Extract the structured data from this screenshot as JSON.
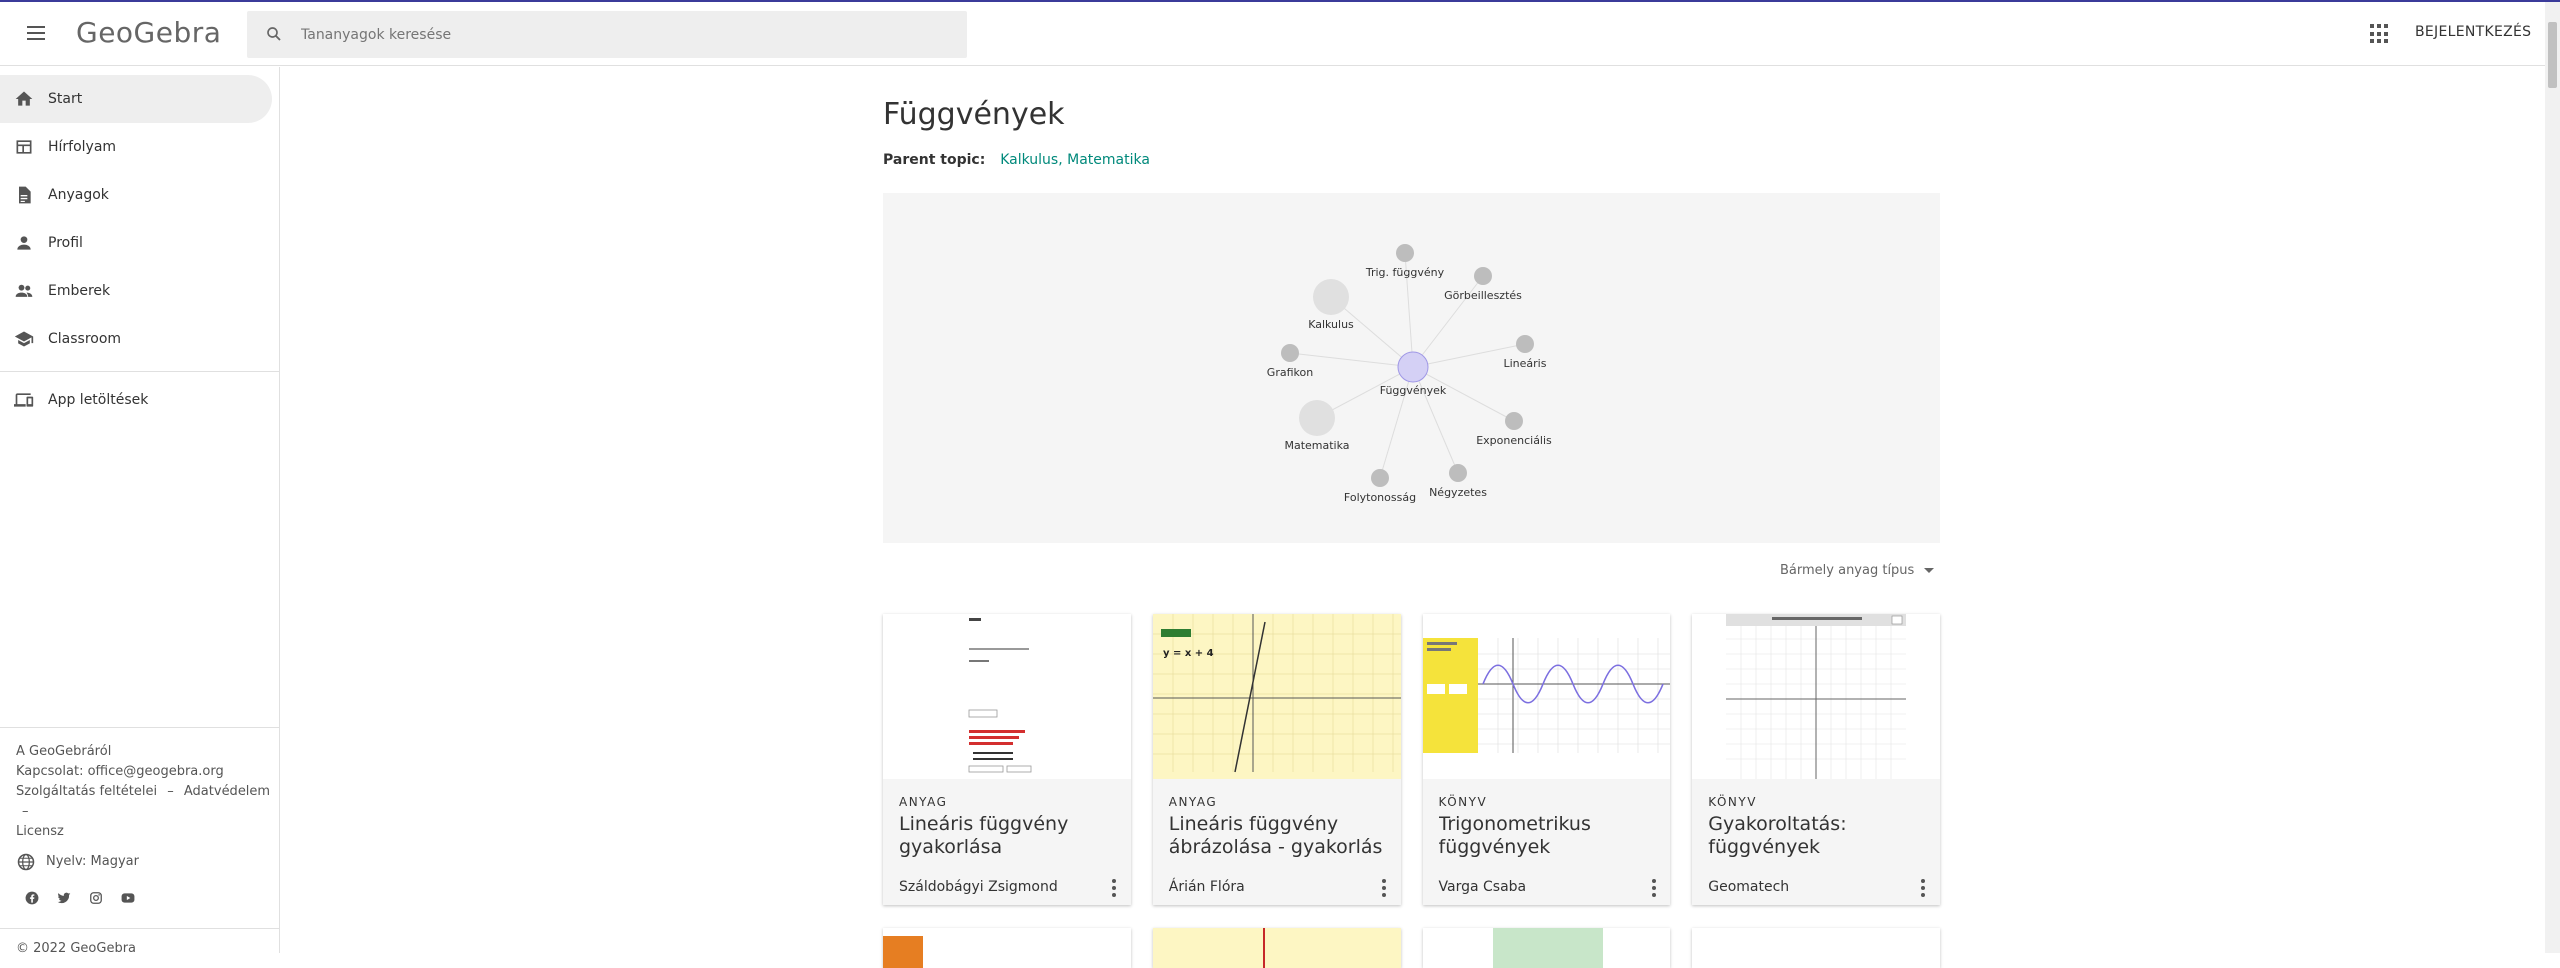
{
  "app": {
    "logo": "GeoGebra"
  },
  "header": {
    "search_placeholder": "Tananyagok keresése",
    "login_label": "BEJELENTKEZÉS"
  },
  "sidebar": {
    "items": [
      {
        "label": "Start",
        "icon": "home-icon"
      },
      {
        "label": "Hírfolyam",
        "icon": "feed-icon"
      },
      {
        "label": "Anyagok",
        "icon": "document-icon"
      },
      {
        "label": "Profil",
        "icon": "person-icon"
      },
      {
        "label": "Emberek",
        "icon": "people-icon"
      },
      {
        "label": "Classroom",
        "icon": "school-icon"
      }
    ],
    "app_downloads": "App letöltések",
    "footer": {
      "about": "A GeoGebráról",
      "contact": "Kapcsolat: office@geogebra.org",
      "terms": "Szolgáltatás feltételei",
      "privacy": "Adatvédelem",
      "license": "Licensz",
      "separator": "–",
      "language": "Nyelv: Magyar",
      "copyright": "© 2022 GeoGebra"
    }
  },
  "page": {
    "title": "Függvények",
    "parent_label": "Parent topic:",
    "parent_links": [
      "Kalkulus",
      "Matematika"
    ],
    "parent_sep": ",",
    "filter_label": "Bármely anyag típus"
  },
  "topic_graph": {
    "center": "Függvények",
    "nodes": [
      "Trig. függvény",
      "Görbeillesztés",
      "Kalkulus",
      "Lineáris",
      "Grafikon",
      "Matematika",
      "Exponenciális",
      "Folytonosság",
      "Négyzetes"
    ],
    "accent": "#d4d0f5"
  },
  "cards": [
    {
      "type": "ANYAG",
      "title": "Lineáris függvény gyakorlása",
      "author": "Száldobágyi Zsigmond"
    },
    {
      "type": "ANYAG",
      "title": "Lineáris függvény ábrázolása - gyakorlás",
      "author": "Árián Flóra",
      "thumb_label": "y = x + 4"
    },
    {
      "type": "KÖNYV",
      "title": "Trigonometrikus függvények ábrázolása",
      "author": "Varga Csaba"
    },
    {
      "type": "KÖNYV",
      "title": "Gyakoroltatás: függvények ábrázolása",
      "author": "Geomatech"
    }
  ],
  "colors": {
    "link": "#00897b",
    "topbar": "#3b3b9a"
  }
}
